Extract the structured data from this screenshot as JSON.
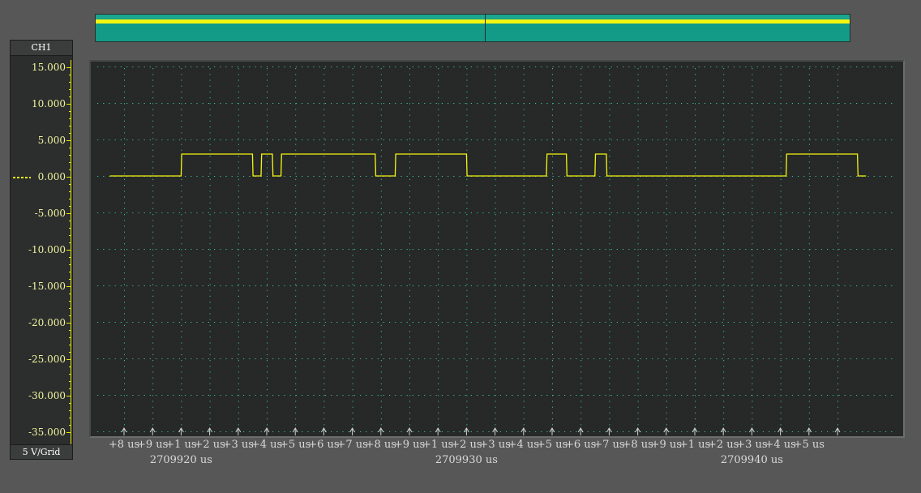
{
  "channel": {
    "name": "CH1",
    "scale": "5 V/Grid",
    "zero_marker_value": 0
  },
  "y_axis": {
    "labels": [
      "15.000",
      "10.000",
      "5.000",
      "0.000",
      "-5.000",
      "-10.000",
      "-15.000",
      "-20.000",
      "-25.000",
      "-30.000",
      "-35.000"
    ]
  },
  "x_axis": {
    "tick_labels": [
      "+8 us",
      "+9 us",
      "+1 us",
      "+2 us",
      "+3 us",
      "+4 us",
      "+5 us",
      "+6 us",
      "+7 us",
      "+8 us",
      "+9 us",
      "+1 us",
      "+2 us",
      "+3 us",
      "+4 us",
      "+5 us",
      "+6 us",
      "+7 us",
      "+8 us",
      "+9 us",
      "+1 us",
      "+2 us",
      "+3 us",
      "+4 us",
      "+5 us"
    ],
    "base_labels": [
      "2709920 us",
      "2709930 us",
      "2709940 us"
    ]
  },
  "colors": {
    "trace": "#f5f512",
    "grid": "#3fbfa2",
    "background": "#262927",
    "overview": "#139b87"
  },
  "chart_data": {
    "type": "line",
    "title": "",
    "xlabel": "",
    "ylabel": "",
    "x_unit": "us",
    "y_unit": "V",
    "ylim": [
      -35,
      15
    ],
    "xlim": [
      2709917.5,
      2709945.5
    ],
    "grid": true,
    "series": [
      {
        "x": [
          2709917.5,
          2709920.0,
          2709920.02,
          2709922.5,
          2709922.52,
          2709922.8,
          2709922.82,
          2709923.2,
          2709923.22,
          2709923.5,
          2709923.52,
          2709926.8,
          2709926.82,
          2709927.5,
          2709927.52,
          2709930.0,
          2709930.02,
          2709932.8,
          2709932.82,
          2709933.5,
          2709933.52,
          2709934.5,
          2709934.52,
          2709934.9,
          2709934.92,
          2709935.3,
          2709935.32,
          2709941.2,
          2709941.22,
          2709943.7,
          2709943.72,
          2709944.0
        ],
        "y": [
          0,
          0,
          3.0,
          3.0,
          0,
          0,
          3.0,
          3.0,
          0,
          0,
          3.0,
          3.0,
          0,
          0,
          3.0,
          3.0,
          0,
          0,
          3.0,
          3.0,
          0,
          0,
          3.0,
          3.0,
          0,
          0,
          0,
          0,
          3.0,
          3.0,
          0,
          0
        ]
      }
    ]
  }
}
